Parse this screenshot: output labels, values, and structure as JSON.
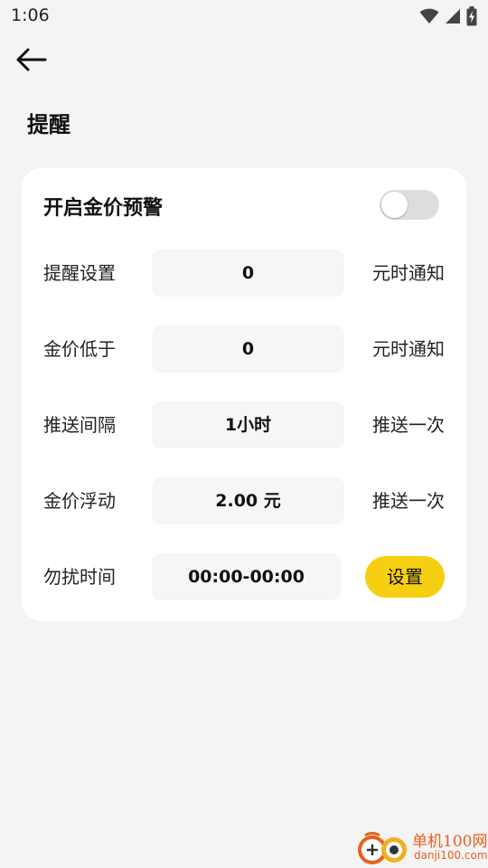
{
  "status_bar": {
    "time": "1:06",
    "icons": [
      "wifi-icon",
      "signal-icon",
      "battery-charging-icon"
    ]
  },
  "header": {
    "back_icon": "arrow-left-icon",
    "title": "提醒"
  },
  "card": {
    "toggle_label": "开启金价预警",
    "toggle_on": false,
    "rows": [
      {
        "label": "提醒设置",
        "value": "0",
        "suffix": "元时通知"
      },
      {
        "label": "金价低于",
        "value": "0",
        "suffix": "元时通知"
      },
      {
        "label": "推送间隔",
        "value": "1小时",
        "suffix": "推送一次"
      },
      {
        "label": "金价浮动",
        "value": "2.00 元",
        "suffix": "推送一次"
      },
      {
        "label": "勿扰时间",
        "value": "00:00-00:00",
        "button": "设置"
      }
    ]
  },
  "watermark": {
    "main": "单机100网",
    "sub": "danji100.com"
  },
  "colors": {
    "accent": "#f7cf12",
    "background": "#f4f4f4",
    "card": "#ffffff",
    "input_bg": "#f6f6f6",
    "toggle_off": "#dddddd",
    "watermark": "#e7601a"
  }
}
